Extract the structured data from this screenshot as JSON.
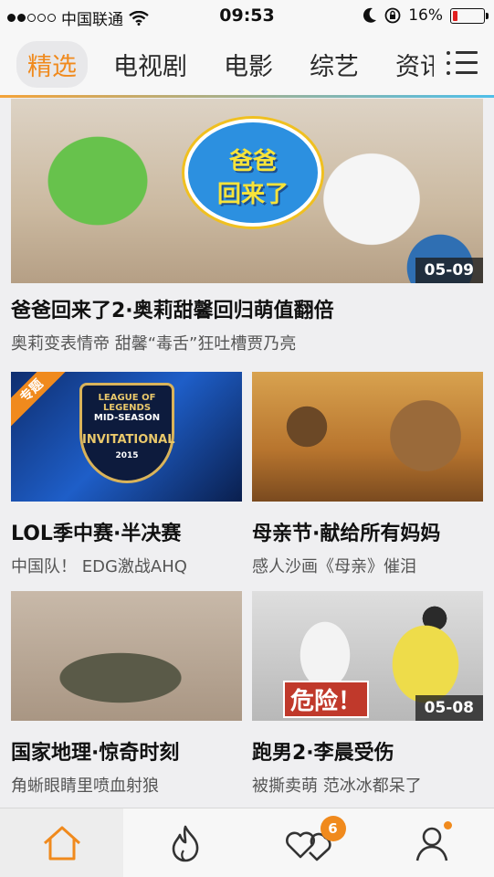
{
  "status": {
    "carrier": "中国联通",
    "time": "09:53",
    "battery": "16%",
    "battery_level": 0.16,
    "signal_bars": 2
  },
  "tabs": [
    {
      "label": "精选",
      "active": true
    },
    {
      "label": "电视剧",
      "active": false
    },
    {
      "label": "电影",
      "active": false
    },
    {
      "label": "综艺",
      "active": false
    },
    {
      "label": "资讯",
      "active": false
    }
  ],
  "feature": {
    "logo_text_1": "爸爸",
    "logo_text_2": "回来了",
    "date": "05-09",
    "title": "爸爸回来了2·奥莉甜馨回归萌值翻倍",
    "subtitle": "奥莉变表情帝 甜馨“毒舌”狂吐槽贾乃亮"
  },
  "cards": [
    {
      "title": "LOL季中赛·半决赛",
      "subtitle": "中国队！ EDG激战AHQ",
      "tag": "专题",
      "art_line_1": "LEAGUE OF LEGENDS",
      "art_line_2": "MID-SEASON",
      "art_line_3": "INVITATIONAL",
      "art_line_4": "2015"
    },
    {
      "title": "母亲节·献给所有妈妈",
      "subtitle": "感人沙画《母亲》催泪"
    },
    {
      "title": "国家地理·惊奇时刻",
      "subtitle": "角蜥眼睛里喷血射狼"
    },
    {
      "title": "跑男2·李晨受伤",
      "subtitle": "被撕卖萌 范冰冰都呆了",
      "date": "05-08",
      "art_text": "危险！"
    }
  ],
  "bottom_nav": {
    "items": [
      {
        "icon": "home-icon",
        "active": true
      },
      {
        "icon": "flame-icon",
        "active": false
      },
      {
        "icon": "hearts-icon",
        "active": false,
        "badge": "6"
      },
      {
        "icon": "profile-icon",
        "active": false,
        "dot": true
      }
    ]
  },
  "colors": {
    "accent": "#f08a1d",
    "tab_underline_start": "#f4a339",
    "tab_underline_end": "#4fbfe9",
    "battery_low": "#e02020"
  }
}
